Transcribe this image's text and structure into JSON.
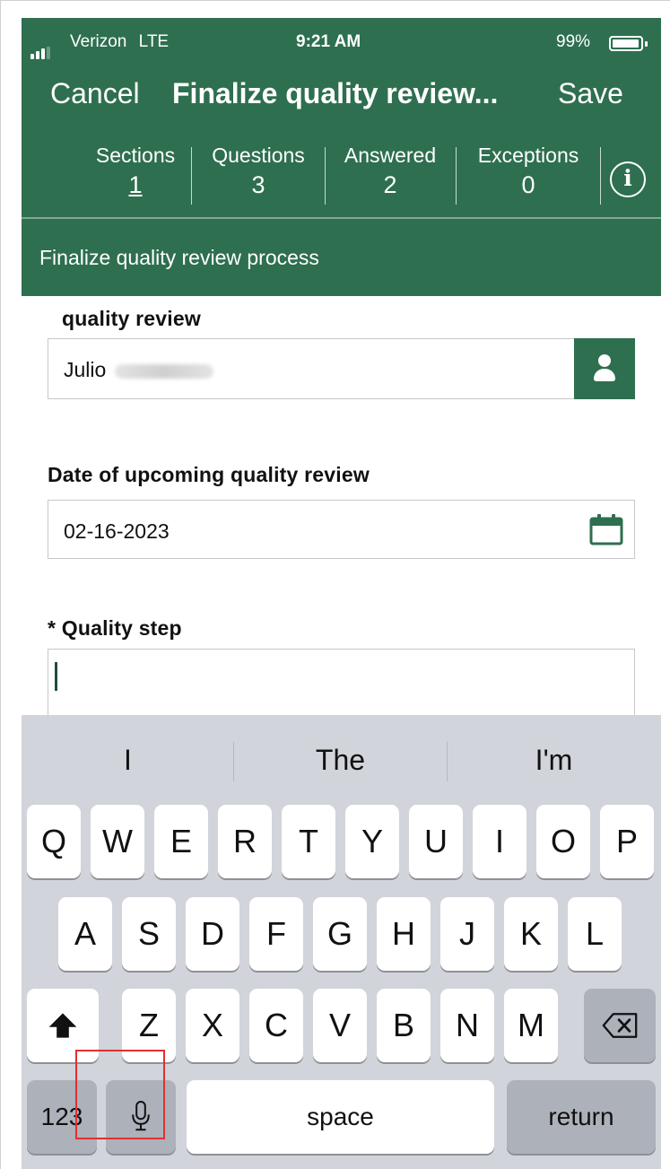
{
  "status_bar": {
    "carrier": "Verizon",
    "network": "LTE",
    "time": "9:21 AM",
    "battery": "99%"
  },
  "nav": {
    "cancel": "Cancel",
    "title": "Finalize quality review...",
    "save": "Save"
  },
  "stats": [
    {
      "label": "Sections",
      "value": "1"
    },
    {
      "label": "Questions",
      "value": "3"
    },
    {
      "label": "Answered",
      "value": "2"
    },
    {
      "label": "Exceptions",
      "value": "0"
    }
  ],
  "subtitle": "Finalize quality review process",
  "form": {
    "reviewer_label": "quality review",
    "reviewer_value": "Julio",
    "date_label": "Date of upcoming quality review",
    "date_value": "02-16-2023",
    "step_label": "* Quality step",
    "step_value": ""
  },
  "keyboard": {
    "suggestions": [
      "I",
      "The",
      "I'm"
    ],
    "row1": [
      "Q",
      "W",
      "E",
      "R",
      "T",
      "Y",
      "U",
      "I",
      "O",
      "P"
    ],
    "row2": [
      "A",
      "S",
      "D",
      "F",
      "G",
      "H",
      "J",
      "K",
      "L"
    ],
    "row3": [
      "Z",
      "X",
      "C",
      "V",
      "B",
      "N",
      "M"
    ],
    "numbers": "123",
    "space": "space",
    "return": "return"
  },
  "colors": {
    "brand": "#2e6f4f",
    "keyboard_bg": "#d1d4da",
    "highlight": "#e03030"
  }
}
